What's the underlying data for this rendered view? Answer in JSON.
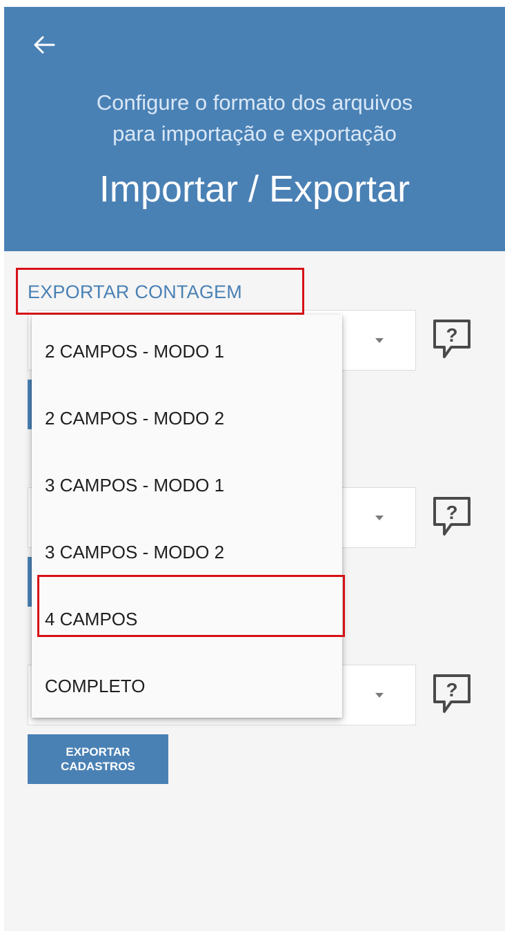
{
  "header": {
    "subtitle": "Configure o formato dos arquivos\npara importação e exportação",
    "title": "Importar / Exportar"
  },
  "sections": [
    {
      "label": "EXPORTAR CONTAGEM",
      "selected": "",
      "button": ""
    },
    {
      "label": "",
      "selected": "",
      "button": ""
    },
    {
      "label": "",
      "selected": "",
      "button": "EXPORTAR\nCADASTROS"
    }
  ],
  "dropdown": {
    "options": [
      "2 CAMPOS - MODO 1",
      "2 CAMPOS - MODO 2",
      "3 CAMPOS - MODO 1",
      "3 CAMPOS - MODO 2",
      "4 CAMPOS",
      "COMPLETO"
    ],
    "highlighted_option": "4 CAMPOS"
  },
  "icons": {
    "back": "arrow-left-icon",
    "help": "help-speech-bubble-icon",
    "caret": "caret-down-icon"
  },
  "colors": {
    "header_bg": "#4a81b5",
    "accent": "#4a81b5",
    "highlight": "#d80f16",
    "screen_bg": "#f5f5f5"
  }
}
